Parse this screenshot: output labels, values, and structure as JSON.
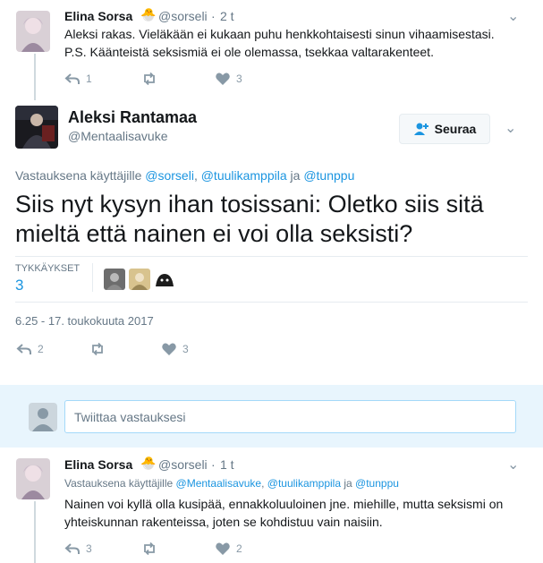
{
  "tweet1": {
    "name": "Elina Sorsa",
    "emoji": "🐣",
    "handle": "@sorseli",
    "time": "2 t",
    "lines": [
      "Aleksi rakas. Vieläkään ei kukaan puhu henkkohtaisesti sinun vihaamisestasi.",
      "P.S. Käänteistä seksismiä ei ole olemassa, tsekkaa valtarakenteet."
    ],
    "reply_count": "1",
    "retweet_count": "",
    "like_count": "3"
  },
  "main": {
    "name": "Aleksi Rantamaa",
    "handle": "@Mentaalisavuke",
    "follow_label": "Seuraa",
    "reply_prefix": "Vastauksena käyttäjille",
    "reply_to_1": "@sorseli",
    "reply_to_2": "@tuulikamppila",
    "reply_join": "ja",
    "reply_to_3": "@tunppu",
    "text": "Siis nyt kysyn ihan tosissani: Oletko siis sitä mieltä että nainen ei voi olla seksisti?",
    "likes_label": "TYKKÄYKSET",
    "likes_count": "3",
    "timestamp": "6.25 - 17. toukokuuta 2017",
    "reply_count": "2",
    "retweet_count": "",
    "like_count": "3"
  },
  "reply_box": {
    "placeholder": "Twiittaa vastauksesi"
  },
  "tweet2": {
    "name": "Elina Sorsa",
    "emoji": "🐣",
    "handle": "@sorseli",
    "time": "1 t",
    "reply_prefix": "Vastauksena käyttäjille",
    "reply_to_1": "@Mentaalisavuke",
    "reply_to_2": "@tuulikamppila",
    "reply_join": "ja",
    "reply_to_3": "@tunppu",
    "lines": [
      "Nainen voi kyllä olla kusipää, ennakkoluuloinen jne. miehille, mutta seksismi on",
      "yhteiskunnan rakenteissa, joten se kohdistuu vain naisiin."
    ],
    "reply_count": "3",
    "retweet_count": "",
    "like_count": "2"
  },
  "colors": {
    "link": "#1b95e0",
    "muted": "#657786",
    "icon": "#8899a6",
    "reply_bg": "#e8f5fd"
  }
}
